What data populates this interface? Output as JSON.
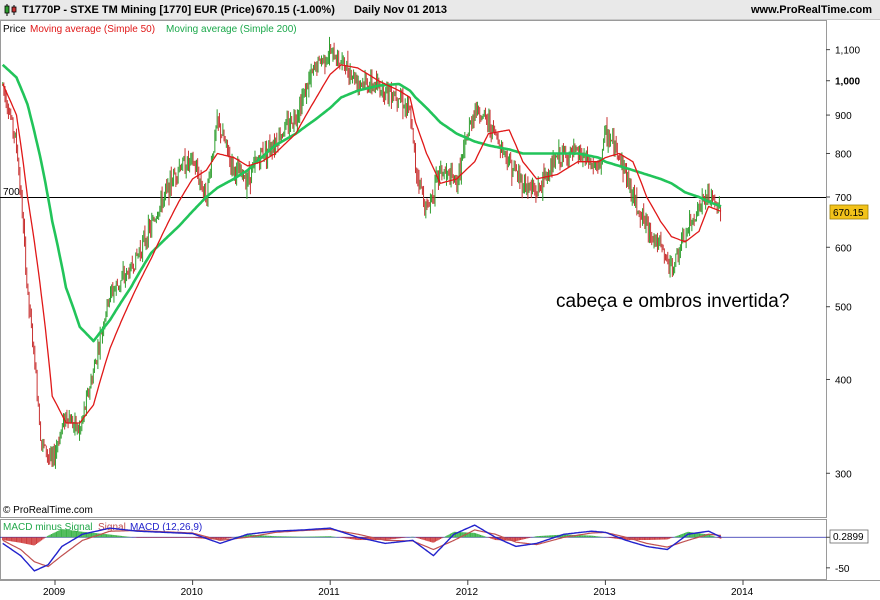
{
  "header": {
    "symbol_title": "T1770P - STXE TM Mining [1770] EUR (Price)",
    "last_quote": "670.15 (-1.00%)",
    "period": "Daily  Nov 01 2013",
    "site": "www.ProRealTime.com"
  },
  "price_panel": {
    "legend_price": "Price",
    "legend_ma50": "Moving average (Simple 50)",
    "legend_ma200": "Moving average (Simple 200)",
    "annotation": "cabeça e ombros invertida?",
    "hline_label": "700",
    "last_price_label": "670.15",
    "copyright": "© ProRealTime.com",
    "y_ticks": [
      "1,100",
      "1,000",
      "900",
      "800",
      "700",
      "600",
      "500",
      "400",
      "300"
    ],
    "scale": "log"
  },
  "macd_panel": {
    "legend_hist": "MACD minus Signal",
    "legend_signal": "Signal",
    "legend_macd": "MACD (12,26,9)",
    "last_value_label": "0.2899",
    "y_ticks": [
      "0",
      "-50"
    ]
  },
  "x_axis": {
    "ticks": [
      "2009",
      "2010",
      "2011",
      "2012",
      "2013",
      "2014"
    ]
  },
  "colors": {
    "price_up": "#2e9e2e",
    "price_down": "#c83232",
    "ma50": "#e01818",
    "ma200": "#22c45a",
    "macd": "#2222cc",
    "signal": "#c05050",
    "hline": "#000000",
    "last_price_box": "#f2c21a"
  },
  "chart_data": {
    "type": "line",
    "title": "T1770P - STXE TM Mining [1770] EUR (Price)",
    "xlabel": "",
    "ylabel": "",
    "ylim": [
      285,
      1140
    ],
    "y_scale": "log",
    "x": [
      2008.62,
      2008.72,
      2008.8,
      2008.9,
      2008.98,
      2009.08,
      2009.18,
      2009.28,
      2009.4,
      2009.55,
      2009.7,
      2009.9,
      2010.0,
      2010.1,
      2010.18,
      2010.3,
      2010.4,
      2010.5,
      2010.6,
      2010.75,
      2010.9,
      2011.0,
      2011.08,
      2011.2,
      2011.35,
      2011.5,
      2011.58,
      2011.62,
      2011.7,
      2011.8,
      2011.92,
      2012.05,
      2012.15,
      2012.3,
      2012.4,
      2012.5,
      2012.65,
      2012.8,
      2012.95,
      2013.0,
      2013.1,
      2013.2,
      2013.3,
      2013.4,
      2013.48,
      2013.58,
      2013.68,
      2013.75,
      2013.84
    ],
    "series": [
      {
        "name": "Price",
        "values": [
          990,
          820,
          520,
          330,
          310,
          360,
          340,
          410,
          520,
          560,
          640,
          770,
          780,
          700,
          880,
          760,
          740,
          800,
          830,
          900,
          1050,
          1090,
          1060,
          1000,
          980,
          960,
          900,
          770,
          670,
          760,
          730,
          920,
          880,
          780,
          730,
          710,
          790,
          800,
          760,
          850,
          800,
          700,
          640,
          600,
          560,
          620,
          680,
          700,
          670.15
        ]
      },
      {
        "name": "Moving average (Simple 50)",
        "values": [
          990,
          900,
          700,
          520,
          380,
          350,
          350,
          370,
          440,
          510,
          580,
          690,
          740,
          760,
          800,
          790,
          770,
          780,
          800,
          850,
          950,
          1020,
          1050,
          1040,
          1000,
          970,
          950,
          880,
          800,
          730,
          740,
          780,
          850,
          860,
          780,
          740,
          750,
          780,
          780,
          790,
          800,
          780,
          700,
          650,
          620,
          610,
          630,
          680,
          670
        ]
      },
      {
        "name": "Moving average (Simple 200)",
        "values": [
          1050,
          1010,
          930,
          780,
          650,
          530,
          470,
          450,
          480,
          530,
          590,
          640,
          670,
          700,
          720,
          740,
          760,
          790,
          820,
          850,
          890,
          920,
          950,
          970,
          985,
          990,
          970,
          950,
          920,
          880,
          850,
          830,
          820,
          810,
          800,
          800,
          800,
          800,
          790,
          780,
          770,
          760,
          750,
          740,
          730,
          710,
          700,
          690,
          680
        ]
      }
    ],
    "macd": {
      "type": "line",
      "name": "MACD (12,26,9)",
      "ylim": [
        -65,
        25
      ],
      "x": [
        2008.62,
        2008.75,
        2008.85,
        2008.95,
        2009.05,
        2009.2,
        2009.4,
        2009.6,
        2009.8,
        2010.0,
        2010.2,
        2010.4,
        2010.6,
        2010.8,
        2011.0,
        2011.2,
        2011.4,
        2011.6,
        2011.75,
        2011.9,
        2012.05,
        2012.2,
        2012.35,
        2012.5,
        2012.7,
        2012.9,
        2013.0,
        2013.15,
        2013.3,
        2013.45,
        2013.6,
        2013.75,
        2013.84
      ],
      "macd_values": [
        -10,
        -30,
        -55,
        -45,
        -15,
        5,
        15,
        10,
        8,
        6,
        -10,
        5,
        10,
        12,
        15,
        0,
        -10,
        -5,
        -30,
        5,
        20,
        0,
        -15,
        -10,
        5,
        10,
        8,
        -5,
        -15,
        -20,
        5,
        10,
        0.29
      ],
      "signal_values": [
        -5,
        -20,
        -40,
        -48,
        -30,
        -5,
        10,
        11,
        9,
        7,
        -5,
        0,
        8,
        11,
        13,
        5,
        -5,
        -6,
        -20,
        -5,
        12,
        5,
        -8,
        -12,
        0,
        7,
        8,
        0,
        -10,
        -16,
        -5,
        5,
        3
      ]
    }
  }
}
